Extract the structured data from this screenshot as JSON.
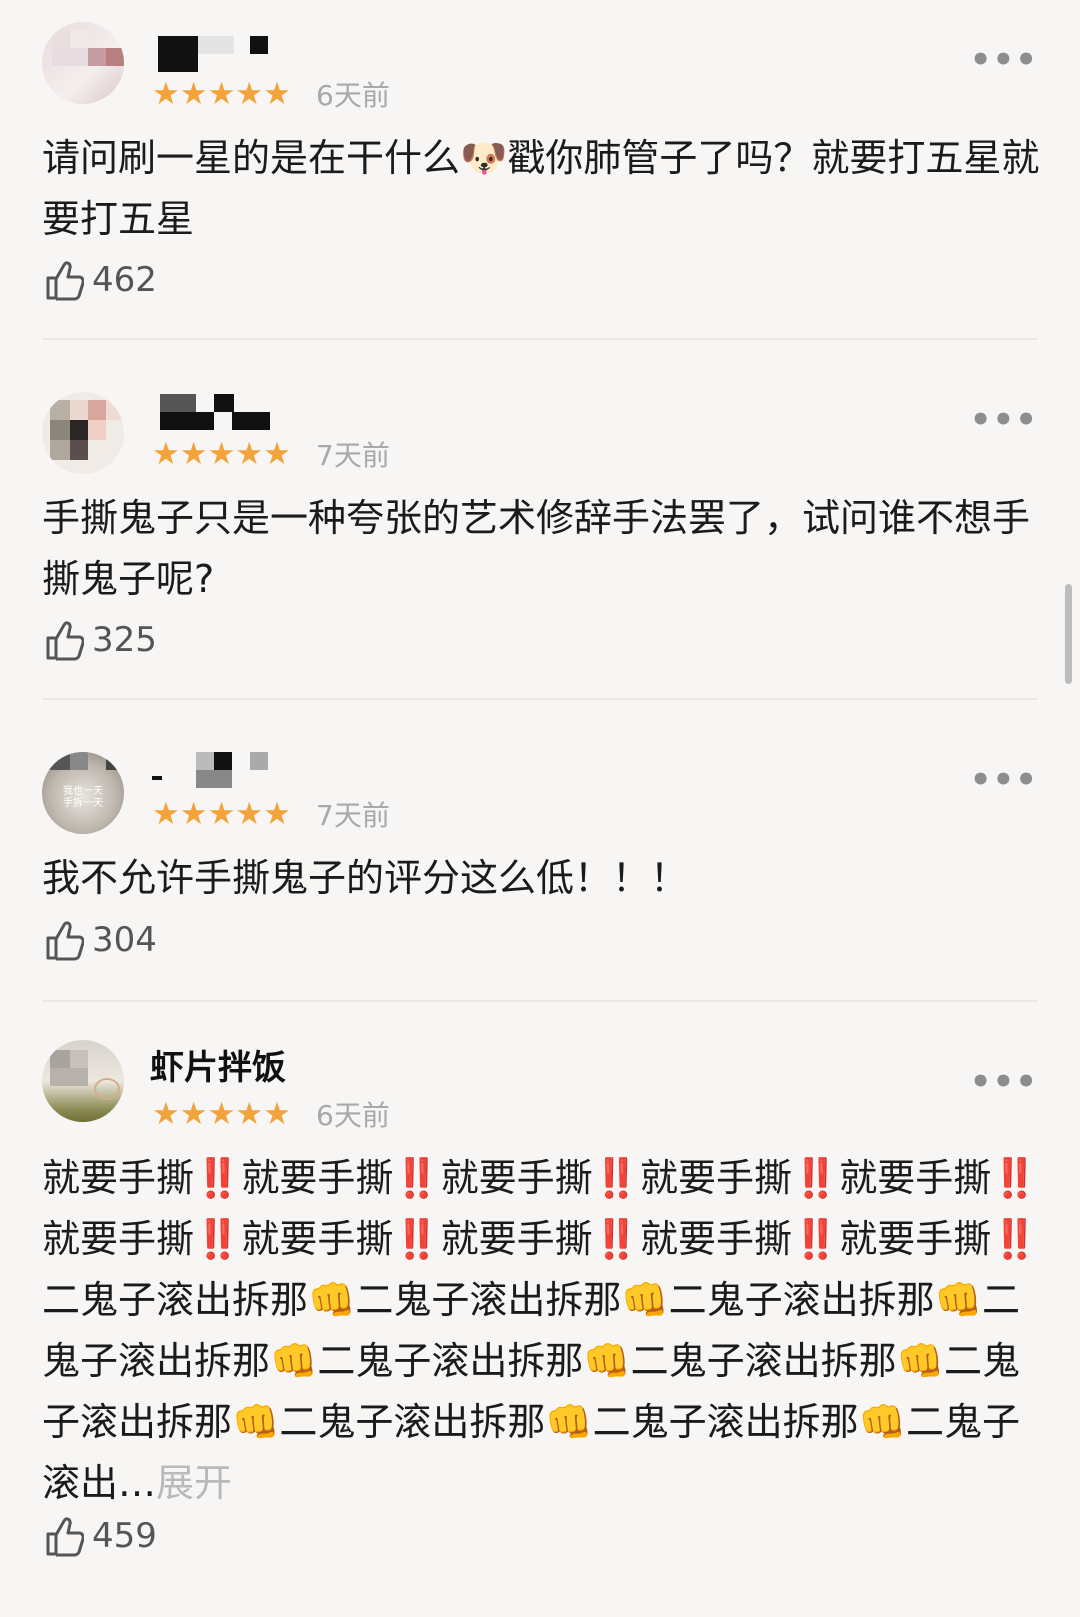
{
  "reviews": [
    {
      "time": "6天前",
      "stars": "★★★★★",
      "text": "请问刷一星的是在干什么🐶戳你肺管子了吗？就要打五星就要打五星",
      "likes": "462",
      "expand": ""
    },
    {
      "time": "7天前",
      "stars": "★★★★★",
      "text": "手撕鬼子只是一种夸张的艺术修辞手法罢了，试问谁不想手撕鬼子呢?",
      "likes": "325",
      "expand": ""
    },
    {
      "time": "7天前",
      "stars": "★★★★★",
      "text": "我不允许手撕鬼子的评分这么低！！！",
      "likes": "304",
      "expand": ""
    },
    {
      "name": "虾片拌饭",
      "time": "6天前",
      "stars": "★★★★★",
      "text": "就要手撕‼️就要手撕‼️就要手撕‼️就要手撕‼️就要手撕‼️就要手撕‼️就要手撕‼️就要手撕‼️就要手撕‼️就要手撕‼️二鬼子滚出拆那👊二鬼子滚出拆那👊二鬼子滚出拆那👊二鬼子滚出拆那👊二鬼子滚出拆那👊二鬼子滚出拆那👊二鬼子滚出拆那👊二鬼子滚出拆那👊二鬼子滚出拆那👊二鬼子滚出…",
      "likes": "459",
      "expand": "展开"
    }
  ],
  "colors": {
    "star": "#f2a43a",
    "background": "#f7f6f5",
    "muted": "#a9a9a9"
  }
}
